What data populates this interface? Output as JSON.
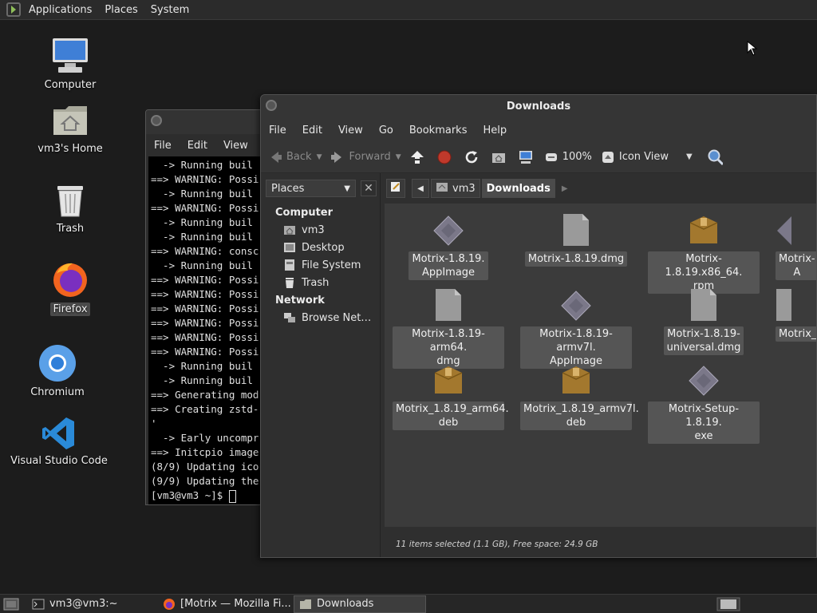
{
  "top_panel": {
    "menus": [
      "Applications",
      "Places",
      "System"
    ]
  },
  "desktop": {
    "icons": [
      {
        "label": "Computer"
      },
      {
        "label": "vm3's Home"
      },
      {
        "label": "Trash"
      },
      {
        "label": "Firefox"
      },
      {
        "label": "Chromium"
      },
      {
        "label": "Visual Studio Code"
      }
    ]
  },
  "terminal": {
    "menus": [
      "File",
      "Edit",
      "View"
    ],
    "lines": [
      "  -> Running buil",
      "==> WARNING: Possi",
      "  -> Running buil",
      "==> WARNING: Possi",
      "  -> Running buil",
      "  -> Running buil",
      "==> WARNING: consc",
      "  -> Running buil",
      "==> WARNING: Possi",
      "==> WARNING: Possi",
      "==> WARNING: Possi",
      "==> WARNING: Possi",
      "==> WARNING: Possi",
      "==> WARNING: Possi",
      "  -> Running buil",
      "  -> Running buil",
      "==> Generating mod",
      "==> Creating zstd-",
      "'",
      "  -> Early uncompr",
      "==> Initcpio image",
      "(8/9) Updating ico",
      "(9/9) Updating the"
    ],
    "prompt": "[vm3@vm3 ~]$ "
  },
  "file_manager": {
    "title": "Downloads",
    "menus": [
      "File",
      "Edit",
      "View",
      "Go",
      "Bookmarks",
      "Help"
    ],
    "toolbar": {
      "back": "Back",
      "forward": "Forward",
      "zoom": "100%",
      "view_mode": "Icon View"
    },
    "sidebar": {
      "selector": "Places",
      "sections": [
        {
          "title": "Computer",
          "items": [
            "vm3",
            "Desktop",
            "File System",
            "Trash"
          ]
        },
        {
          "title": "Network",
          "items": [
            "Browse Net…"
          ]
        }
      ]
    },
    "path": [
      "vm3",
      "Downloads"
    ],
    "files": [
      {
        "name": "Motrix-1.8.19.\nAppImage",
        "type": "appimage"
      },
      {
        "name": "Motrix-1.8.19.dmg",
        "type": "generic"
      },
      {
        "name": "Motrix-1.8.19.x86_64.\nrpm",
        "type": "package"
      },
      {
        "name": "Motrix-\nA",
        "type": "appimage"
      },
      {
        "name": "Motrix-1.8.19-arm64.\ndmg",
        "type": "generic"
      },
      {
        "name": "Motrix-1.8.19-armv7l.\nAppImage",
        "type": "appimage"
      },
      {
        "name": "Motrix-1.8.19-\nuniversal.dmg",
        "type": "generic"
      },
      {
        "name": "Motrix_",
        "type": "generic"
      },
      {
        "name": "Motrix_1.8.19_arm64.\ndeb",
        "type": "package"
      },
      {
        "name": "Motrix_1.8.19_armv7l.\ndeb",
        "type": "package"
      },
      {
        "name": "Motrix-Setup-1.8.19.\nexe",
        "type": "appimage"
      }
    ],
    "status": "11 items selected (1.1 GB), Free space: 24.9 GB"
  },
  "taskbar": {
    "tasks": [
      {
        "label": "vm3@vm3:~"
      },
      {
        "label": "[Motrix — Mozilla Fi..."
      },
      {
        "label": "Downloads"
      }
    ]
  },
  "colors": {
    "desktop_bg": "#1c1c1c",
    "panel_bg": "#2b2b2b",
    "selection": "#555555",
    "accent_blue": "#3a8ee6"
  }
}
